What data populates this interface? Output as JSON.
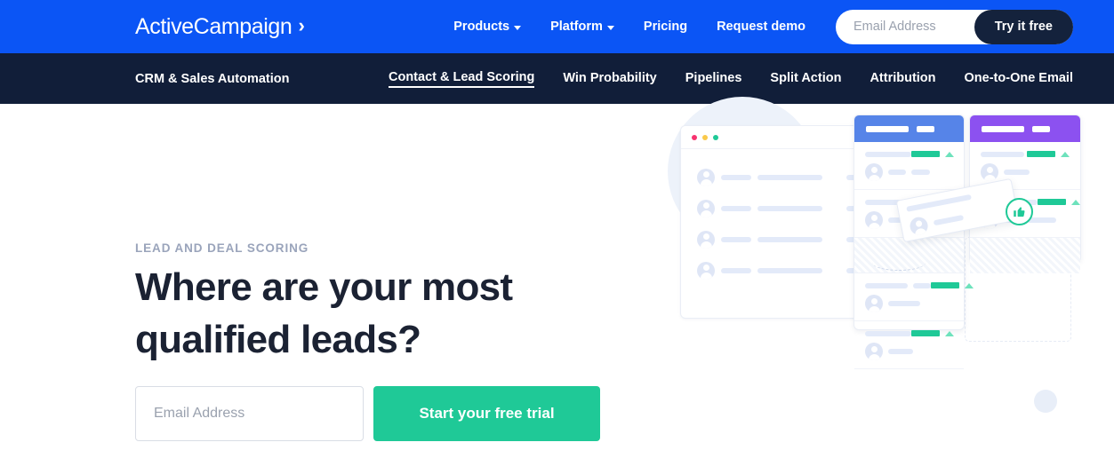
{
  "brand": {
    "name": "ActiveCampaign",
    "chevron": "›",
    "blue": "#0b55f5",
    "navy": "#111e39",
    "green": "#1fc997",
    "pink": "#f7336f"
  },
  "topnav": {
    "items": [
      {
        "label": "Products",
        "has_caret": true
      },
      {
        "label": "Platform",
        "has_caret": true
      },
      {
        "label": "Pricing",
        "has_caret": false
      },
      {
        "label": "Request demo",
        "has_caret": false
      }
    ],
    "email_placeholder": "Email Address",
    "email_value": "",
    "cta_label": "Try it free"
  },
  "subnav": {
    "title": "CRM & Sales Automation",
    "items": [
      {
        "label": "Contact & Lead Scoring",
        "active": true
      },
      {
        "label": "Win Probability",
        "active": false
      },
      {
        "label": "Pipelines",
        "active": false
      },
      {
        "label": "Split Action",
        "active": false
      },
      {
        "label": "Attribution",
        "active": false
      },
      {
        "label": "One-to-One Email",
        "active": false
      }
    ]
  },
  "hero": {
    "eyebrow": "LEAD AND DEAL SCORING",
    "headline": "Where are your most qualified leads?",
    "email_placeholder": "Email Address",
    "email_value": "",
    "cta_label": "Start your free trial"
  },
  "illustration": {
    "window_dots": [
      "#f7336f",
      "#fac94a",
      "#1fc997"
    ],
    "rows": [
      {
        "score_color": "#1fc997",
        "trend": "up"
      },
      {
        "score_color": "#1fc997",
        "trend": "up"
      },
      {
        "score_color": "#f7336f",
        "trend": "down"
      },
      {
        "score_color": "#1fc997",
        "trend": "up"
      }
    ],
    "blue_card": {
      "header_color": "#5684e8",
      "items": [
        {
          "score_color": "#1fc997",
          "trend": "up"
        },
        {
          "score_color": "#f7336f",
          "trend": "down"
        },
        {
          "score_color": "#1fc997",
          "trend": "up"
        },
        {
          "score_color": "#1fc997",
          "trend": "up"
        }
      ]
    },
    "purple_card": {
      "header_color": "#8c51f0",
      "items": [
        {
          "score_color": "#1fc997",
          "trend": "up"
        },
        {
          "score_color": "#1fc997",
          "trend": "up"
        }
      ]
    },
    "thumbs_up_icon": "👍"
  }
}
